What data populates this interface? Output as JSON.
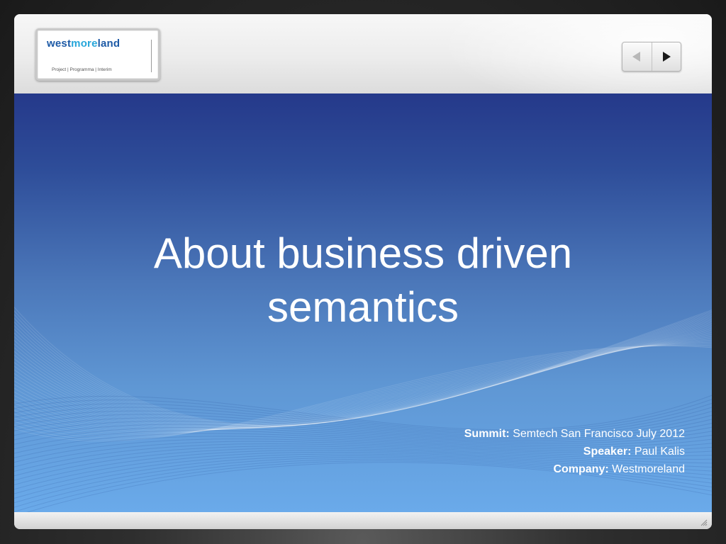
{
  "logo": {
    "part1": "west",
    "part2": "more",
    "part3": "land",
    "tagline": "Project | Programma | Interim"
  },
  "nav": {
    "prev_icon": "triangle-left-icon",
    "next_icon": "triangle-right-icon"
  },
  "slide": {
    "title_line1": "About business driven",
    "title_line2": "semantics",
    "details": [
      {
        "label": "Summit:",
        "value": "Semtech San Francisco July 2012"
      },
      {
        "label": "Speaker:",
        "value": "Paul Kalis"
      },
      {
        "label": "Company:",
        "value": "Westmoreland"
      }
    ]
  },
  "colors": {
    "slide_top": "#25398a",
    "slide_bottom": "#6aaaea",
    "logo_dark_blue": "#1d5aa6",
    "logo_light_blue": "#27a6da"
  }
}
